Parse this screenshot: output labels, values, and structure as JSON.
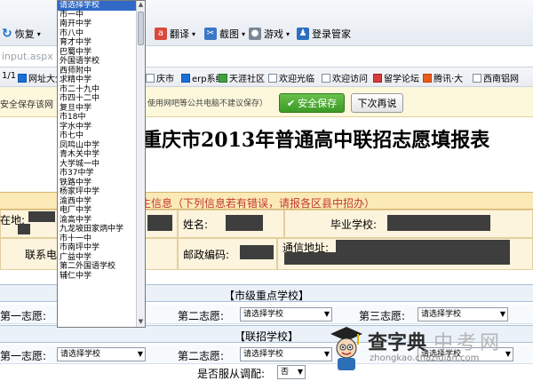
{
  "toolbar": {
    "recover_label": "恢复",
    "translate_label": "翻译",
    "screenshot_label": "截图",
    "games_label": "游戏",
    "login_label": "登录管家"
  },
  "address_bar": {
    "url": "input.aspx"
  },
  "favorites": [
    {
      "label": "网址大全",
      "icon": "globe-icon"
    },
    {
      "label": "庆市",
      "icon": "page-icon"
    },
    {
      "label": "erp系统",
      "icon": "page-icon"
    },
    {
      "label": "天涯社区",
      "icon": "tianya-icon"
    },
    {
      "label": "欢迎光临",
      "icon": "page-icon"
    },
    {
      "label": "欢迎访问",
      "icon": "page-icon"
    },
    {
      "label": "留学论坛",
      "icon": "forum-icon"
    },
    {
      "label": "腾讯·大",
      "icon": "tencent-icon"
    },
    {
      "label": "西南铝网",
      "icon": "page-icon"
    }
  ],
  "favbar_prefix": "1/1",
  "savebar": {
    "message": "安全保存该网",
    "hint": "使用网吧等公共电脑不建议保存）",
    "save_label": "安全保存",
    "later_label": "下次再说"
  },
  "page": {
    "title": "重庆市2013年普通高中联招志愿填报表",
    "notice": "生信息（下列信息若有错误，请报各区县中招办）",
    "labels": {
      "location": "在地:",
      "name": "姓名:",
      "grad_school": "毕业学校:",
      "phone": "联系电话",
      "postcode": "邮政编码:",
      "address": "通信地址:"
    },
    "section_key": "【市级重点学校】",
    "section_joint": "【联招学校】",
    "wish1": "第一志愿:",
    "wish2": "第二志愿:",
    "wish3": "第三志愿:",
    "select_placeholder": "请选择学校",
    "adjust_label": "是否服从调配:",
    "adjust_value": "否"
  },
  "dropdown_options": [
    "请选择学校",
    "市一中",
    "南开中学",
    "市八中",
    "育才中学",
    "巴蜀中学",
    "外国语学校",
    "西师附中",
    "求精中学",
    "市二十九中",
    "市四十二中",
    "复旦中学",
    "市18中",
    "字水中学",
    "市七中",
    "凤鸣山中学",
    "青木关中学",
    "大学城一中",
    "市37中学",
    "铁路中学",
    "杨家坪中学",
    "渝西中学",
    "电厂中学",
    "渝高中学",
    "九龙坡田家炳中学",
    "市十一中",
    "市南坪中学",
    "广益中学",
    "第二外国语学校",
    "辅仁中学"
  ],
  "watermark": {
    "brand": "查字典",
    "brand2": "中考网",
    "url": "zhongkao.chazidian.com"
  }
}
